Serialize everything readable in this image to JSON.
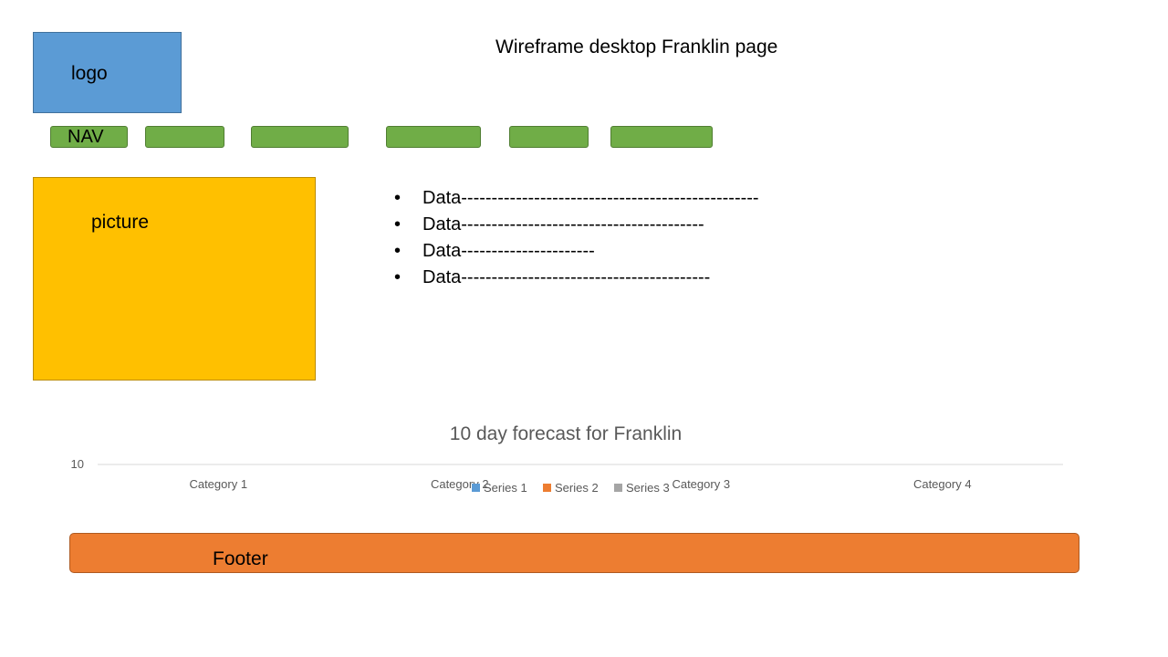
{
  "page": {
    "title": "Wireframe desktop Franklin page"
  },
  "logo": {
    "label": "logo",
    "color": "#5b9bd5"
  },
  "nav": {
    "items": [
      "NAV",
      "",
      "",
      "",
      "",
      ""
    ],
    "color": "#70ad47"
  },
  "picture": {
    "label": "picture",
    "color": "#ffc000"
  },
  "bullets": {
    "items": [
      "Data-------------------------------------------------",
      "Data----------------------------------------",
      "Data----------------------",
      "Data-----------------------------------------"
    ]
  },
  "chart_data": {
    "type": "bar",
    "title": "10 day forecast for Franklin",
    "categories": [
      "Category 1",
      "Category 2",
      "Category 3",
      "Category 4"
    ],
    "series": [
      {
        "name": "Series 1",
        "color": "#5b9bd5",
        "values": []
      },
      {
        "name": "Series 2",
        "color": "#ed7d31",
        "values": []
      },
      {
        "name": "Series 3",
        "color": "#a5a5a5",
        "values": []
      }
    ],
    "ytick_labels": [
      "10"
    ],
    "legend": "bottom",
    "grid": true
  },
  "footer": {
    "label": "Footer",
    "color": "#ed7d31"
  }
}
